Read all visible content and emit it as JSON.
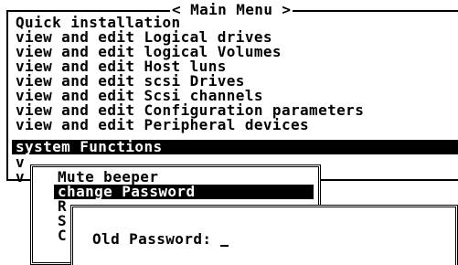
{
  "main_menu": {
    "title": "< Main Menu >",
    "items": [
      "Quick installation",
      "view and edit Logical drives",
      "view and edit logical Volumes",
      "view and edit Host luns",
      "view and edit scsi Drives",
      "view and edit Scsi channels",
      "view and edit Configuration parameters",
      "view and edit Peripheral devices",
      "system Functions",
      "v",
      "v"
    ],
    "selected_index": 8
  },
  "submenu": {
    "items": [
      "Mute beeper",
      "change Password",
      "R",
      "S",
      "C"
    ],
    "selected_index": 1
  },
  "password_dialog": {
    "label": "Old Password: "
  },
  "colors": {
    "background": "#ffffff",
    "foreground": "#000000",
    "highlight_bg": "#000000",
    "highlight_fg": "#ffffff"
  }
}
